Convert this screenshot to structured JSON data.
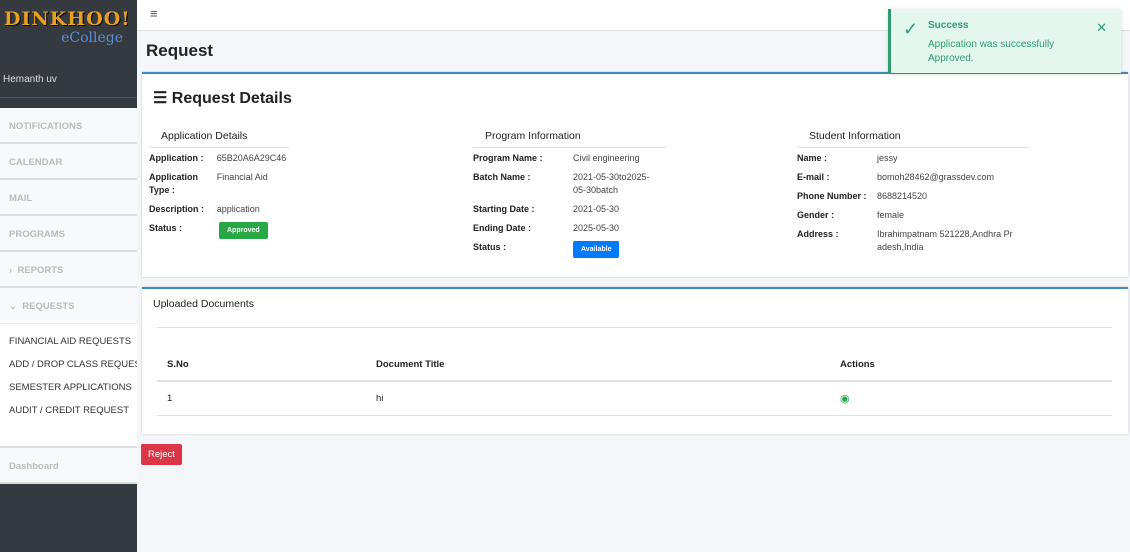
{
  "sidebar": {
    "logo_text": "DINKHOO!",
    "logo_sub": "eCollege",
    "user": "Hemanth uv",
    "items": [
      "NOTIFICATIONS",
      "CALENDAR",
      "MAIL",
      "PROGRAMS",
      "REPORTS",
      "REQUESTS"
    ],
    "sub_items": [
      "FINANCIAL AID REQUESTS",
      "ADD / DROP CLASS REQUESTS",
      "SEMESTER APPLICATIONS",
      "AUDIT / CREDIT REQUEST"
    ],
    "dashboard": "Dashboard"
  },
  "page": {
    "title": "Request"
  },
  "details": {
    "title": "Request Details",
    "application": {
      "heading": "Application Details",
      "rows": [
        [
          "Application :",
          "65B20A6A29C46"
        ],
        [
          "Application Type :",
          "Financial Aid"
        ],
        [
          "Description :",
          "application"
        ]
      ],
      "status_label": "Status :",
      "status": "Approved",
      "status_color": "#28a745"
    },
    "program": {
      "heading": "Program Information",
      "rows": [
        [
          "Program Name :",
          "Civil engineering"
        ],
        [
          "Batch Name :",
          "2021-05-30to2025-05-30batch"
        ],
        [
          "Starting Date :",
          "2021-05-30"
        ],
        [
          "Ending Date :",
          "2025-05-30"
        ]
      ],
      "status_label": "Status :",
      "status": "Available",
      "status_color": "#007bff"
    },
    "student": {
      "heading": "Student Information",
      "rows": [
        [
          "Name :",
          "jessy"
        ],
        [
          "E-mail :",
          "bomoh28462@grassdev.com"
        ],
        [
          "Phone Number :",
          "8688214520"
        ],
        [
          "Gender :",
          "female"
        ],
        [
          "Address :",
          "Ibrahimpatnam 521228,Andhra Pradesh,India"
        ]
      ]
    }
  },
  "documents": {
    "title": "Uploaded Documents",
    "columns": [
      "S.No",
      "Document Title",
      "Actions"
    ],
    "rows": [
      [
        "1",
        "hi"
      ]
    ]
  },
  "reject_label": "Reject",
  "toast": {
    "title": "Success",
    "message": "Application was successfully Approved."
  }
}
